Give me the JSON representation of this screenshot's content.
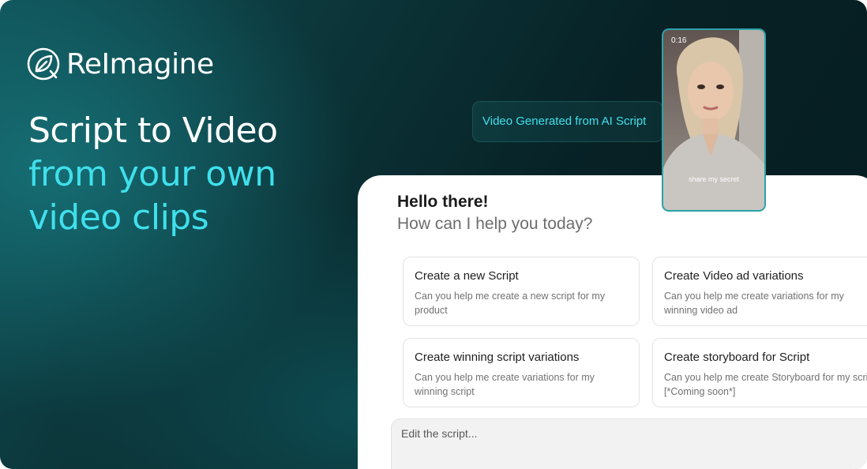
{
  "brand": {
    "name": "ReImagine",
    "icon": "leaf-logo-icon"
  },
  "headline": {
    "line1": "Script to Video",
    "line2": "from your own",
    "line3": "video clips"
  },
  "badge": {
    "label": "Video Generated from AI Script"
  },
  "video": {
    "timestamp": "0:16",
    "caption": "share my secret"
  },
  "chat": {
    "greeting": "Hello there!",
    "prompt": "How can I help you today?",
    "cards": [
      {
        "title": "Create a new Script",
        "description": "Can you help me create a new script for my product"
      },
      {
        "title": "Create Video ad variations",
        "description": "Can you help me create variations for my winning video ad"
      },
      {
        "title": "Create winning script variations",
        "description": "Can you help me create variations for my winning script"
      },
      {
        "title": "Create storyboard for Script",
        "description": "Can you help me create Storyboard for my script [*Coming soon*]"
      }
    ],
    "input": {
      "placeholder": "Edit the script..."
    }
  },
  "colors": {
    "accent": "#3fe0ec",
    "background": "#072125",
    "video_border": "#2aa2a8"
  }
}
